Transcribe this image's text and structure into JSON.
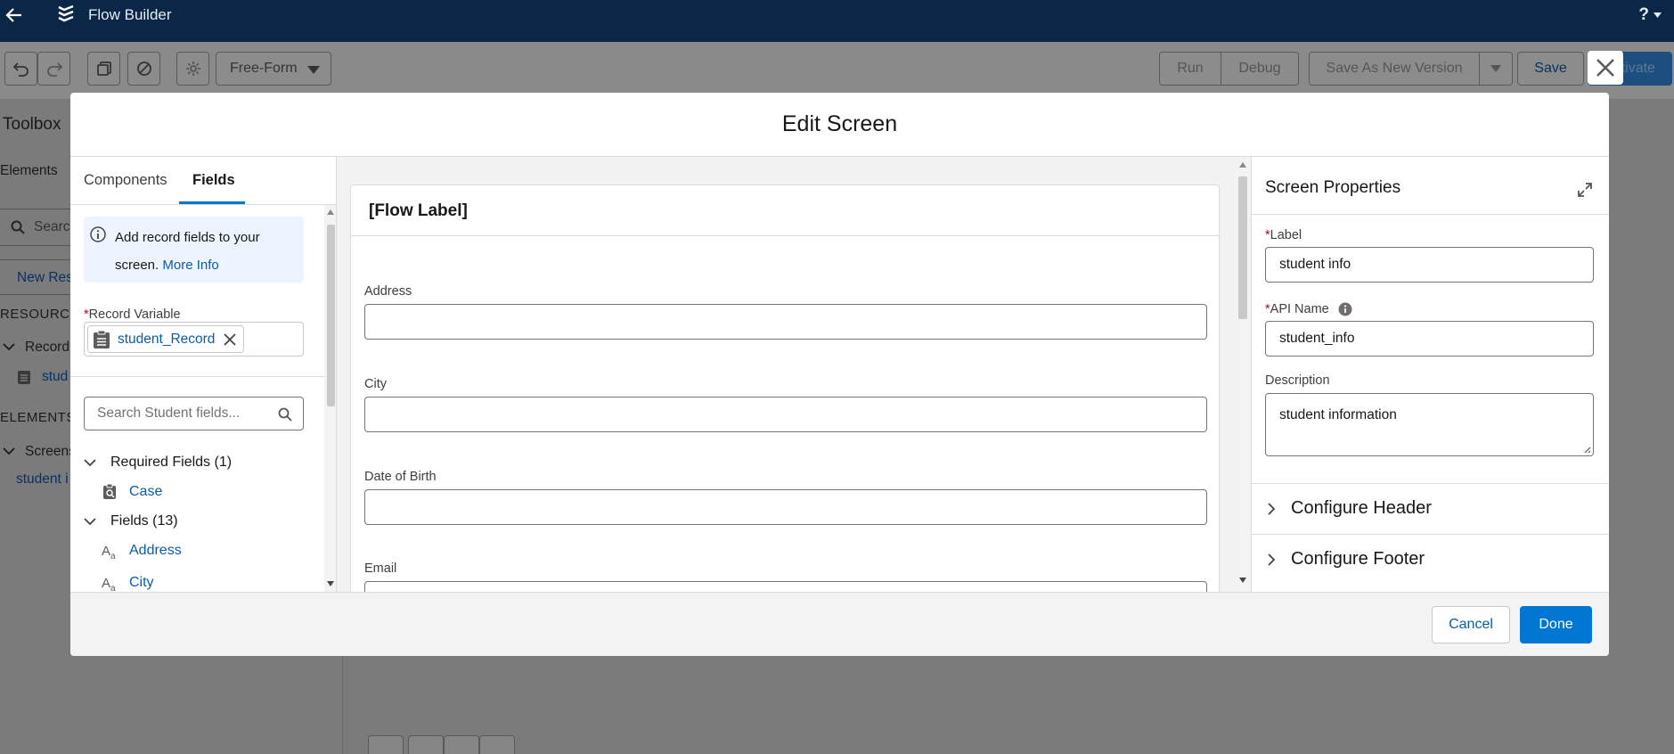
{
  "app": {
    "title": "Flow Builder",
    "help": "?"
  },
  "toolbar": {
    "layout_mode": "Free-Form",
    "run_label": "Run",
    "debug_label": "Debug",
    "save_as_new_label": "Save As New Version",
    "save_label": "Save",
    "activate_label": "Activate"
  },
  "sidebar": {
    "title": "Toolbox",
    "elements_tab": "Elements",
    "search_placeholder": "Search",
    "new_resource_label": "New Res",
    "resources_heading": "RESOURCES",
    "record_group": "Record",
    "record_item": "stud",
    "elements_heading": "ELEMENTS",
    "screens_group": "Screens",
    "screen_item": "student i"
  },
  "modal": {
    "title": "Edit Screen",
    "left": {
      "tabs": [
        "Components",
        "Fields"
      ],
      "active_tab": "Fields",
      "info_text": "Add record fields to your screen.",
      "info_link": "More Info",
      "record_variable_label": "Record Variable",
      "record_variable_value": "student_Record",
      "search_placeholder": "Search Student fields...",
      "required_group": "Required Fields (1)",
      "required_fields": [
        "Case"
      ],
      "fields_group": "Fields (13)",
      "fields": [
        "Address",
        "City"
      ]
    },
    "preview": {
      "flow_label": "[Flow Label]",
      "fields": [
        "Address",
        "City",
        "Date of Birth",
        "Email"
      ]
    },
    "properties": {
      "title": "Screen Properties",
      "label_label": "Label",
      "label_value": "student info",
      "api_name_label": "API Name",
      "api_name_value": "student_info",
      "description_label": "Description",
      "description_value": "student information",
      "sections": [
        "Configure Header",
        "Configure Footer"
      ]
    },
    "footer": {
      "cancel_label": "Cancel",
      "done_label": "Done"
    }
  }
}
